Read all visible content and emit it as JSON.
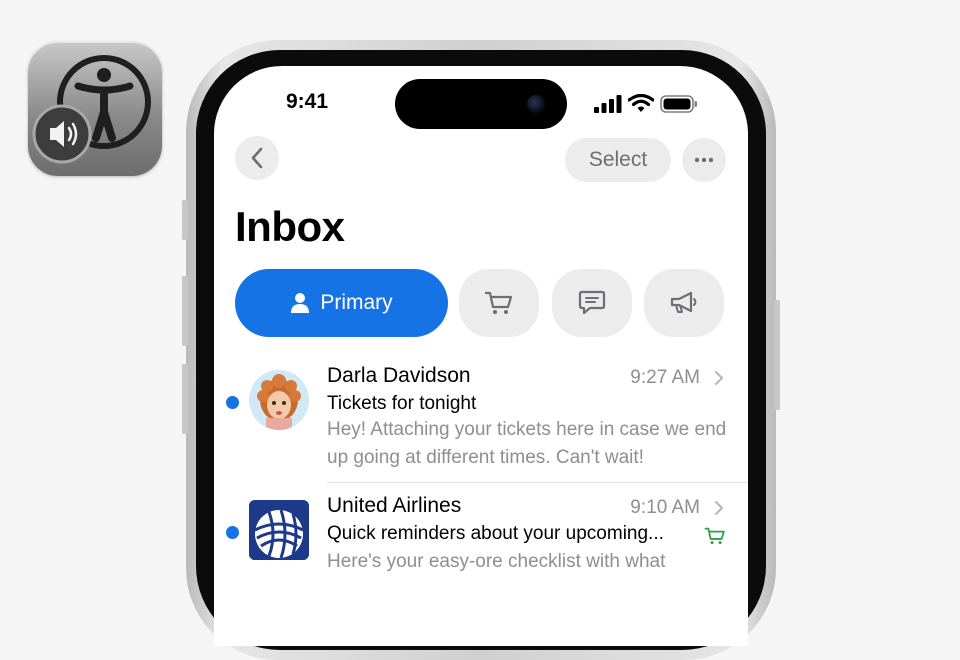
{
  "status_bar": {
    "time": "9:41"
  },
  "nav": {
    "select_label": "Select"
  },
  "title": "Inbox",
  "tabs": [
    {
      "label": "Primary",
      "icon": "person-icon",
      "selected": true
    },
    {
      "label": "",
      "icon": "cart-icon",
      "selected": false
    },
    {
      "label": "",
      "icon": "chat-bubble-icon",
      "selected": false
    },
    {
      "label": "",
      "icon": "megaphone-icon",
      "selected": false
    }
  ],
  "messages": [
    {
      "sender": "Darla Davidson",
      "time": "9:27 AM",
      "subject": "Tickets for tonight",
      "preview": "Hey! Attaching your tickets here in case we end up going at different times. Can't wait!",
      "unread": true,
      "avatar": "memoji-avatar"
    },
    {
      "sender": "United Airlines",
      "time": "9:10 AM",
      "subject": "Quick reminders about your upcoming...",
      "preview": "Here's your easy-ore checklist with what",
      "unread": true,
      "avatar": "globe-logo-avatar",
      "category_icon": "cart-icon"
    }
  ],
  "colors": {
    "accent": "#1673e6",
    "secondary_text": "#8e8e93",
    "chip_bg": "#ececec"
  }
}
